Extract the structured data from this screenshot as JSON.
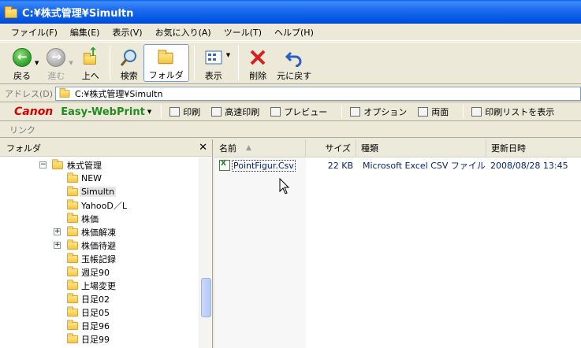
{
  "window": {
    "title": "C:¥株式管理¥Simultn"
  },
  "menu": [
    "ファイル(F)",
    "編集(E)",
    "表示(V)",
    "お気に入り(A)",
    "ツール(T)",
    "ヘルプ(H)"
  ],
  "toolbar": {
    "back": "戻る",
    "forward": "進む",
    "up": "上へ",
    "search": "検索",
    "folders": "フォルダ",
    "views": "表示",
    "delete": "削除",
    "undo": "元に戻す"
  },
  "address": {
    "label": "アドレス(D)",
    "value": "C:¥株式管理¥Simultn"
  },
  "canon": {
    "logo": "Canon",
    "product": "Easy-WebPrint",
    "print": "印刷",
    "hq_print": "高速印刷",
    "preview": "プレビュー",
    "options": "オプション",
    "duplex": "両面",
    "print_list": "印刷リストを表示"
  },
  "links": {
    "label": "リンク"
  },
  "folder_pane": {
    "title": "フォルダ",
    "items": [
      {
        "label": "株式管理",
        "expander": "−",
        "level": 0
      },
      {
        "label": "NEW",
        "expander": "",
        "level": 1
      },
      {
        "label": "Simultn",
        "expander": "",
        "level": 1,
        "selected": true
      },
      {
        "label": "YahooD／L",
        "expander": "",
        "level": 1
      },
      {
        "label": "株価",
        "expander": "",
        "level": 1
      },
      {
        "label": "株価解凍",
        "expander": "+",
        "level": 1
      },
      {
        "label": "株価待避",
        "expander": "+",
        "level": 1
      },
      {
        "label": "玉帳記録",
        "expander": "",
        "level": 1
      },
      {
        "label": "週足90",
        "expander": "",
        "level": 1
      },
      {
        "label": "上場変更",
        "expander": "",
        "level": 1
      },
      {
        "label": "日足02",
        "expander": "",
        "level": 1
      },
      {
        "label": "日足05",
        "expander": "",
        "level": 1
      },
      {
        "label": "日足96",
        "expander": "",
        "level": 1
      },
      {
        "label": "日足99",
        "expander": "",
        "level": 1
      }
    ]
  },
  "list": {
    "columns": {
      "name": "名前",
      "size": "サイズ",
      "type": "種類",
      "modified": "更新日時"
    },
    "rows": [
      {
        "name": "PointFigur.Csv",
        "size": "22 KB",
        "type": "Microsoft Excel CSV ファイル",
        "modified": "2008/08/28 13:45"
      }
    ]
  }
}
